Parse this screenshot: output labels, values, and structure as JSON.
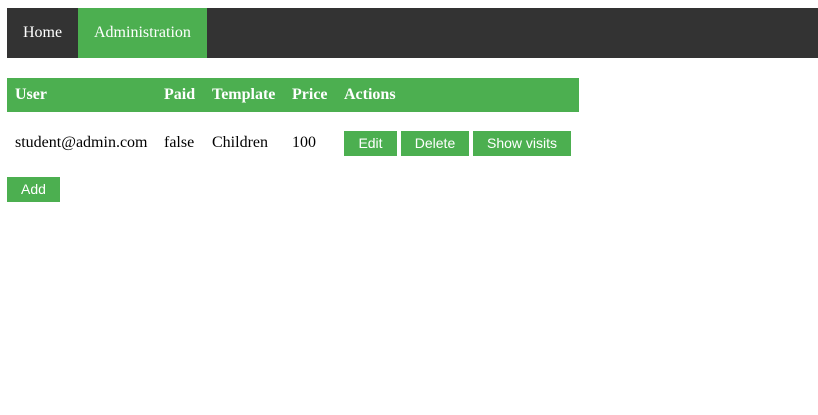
{
  "nav": {
    "items": [
      {
        "label": "Home"
      },
      {
        "label": "Administration"
      }
    ],
    "active": "Administration"
  },
  "table": {
    "headers": [
      "User",
      "Paid",
      "Template",
      "Price",
      "Actions"
    ],
    "rows": [
      {
        "user": "student@admin.com",
        "paid": "false",
        "template": "Children",
        "price": "100"
      }
    ],
    "actions": {
      "edit_label": "Edit",
      "delete_label": "Delete",
      "show_visits_label": "Show visits"
    }
  },
  "add_label": "Add",
  "colors": {
    "nav_bg": "#333333",
    "accent": "#4caf50",
    "text_light": "#ffffff"
  }
}
